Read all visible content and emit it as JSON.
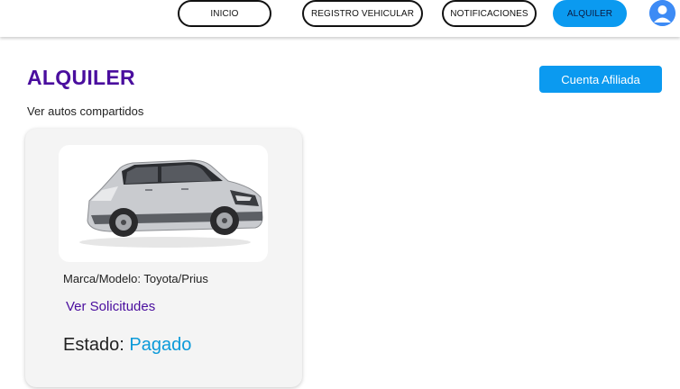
{
  "nav": {
    "items": [
      {
        "label": "INICIO"
      },
      {
        "label": "REGISTRO VEHICULAR"
      },
      {
        "label": "NOTIFICACIONES"
      },
      {
        "label": "ALQUILER",
        "active": true
      }
    ]
  },
  "page": {
    "title": "ALQUILER",
    "subtitle": "Ver autos compartidos",
    "affiliate_button": "Cuenta Afiliada"
  },
  "car": {
    "model_label": "Marca/Modelo: Toyota/Prius",
    "view_requests": "Ver Solicitudes",
    "status_label": "Estado:",
    "status_value": "Pagado"
  },
  "colors": {
    "accent_blue": "#0b9af0",
    "title_purple": "#4a0e9e",
    "status_blue": "#0b9ad9"
  },
  "icons": {
    "avatar": "user-avatar-icon"
  }
}
